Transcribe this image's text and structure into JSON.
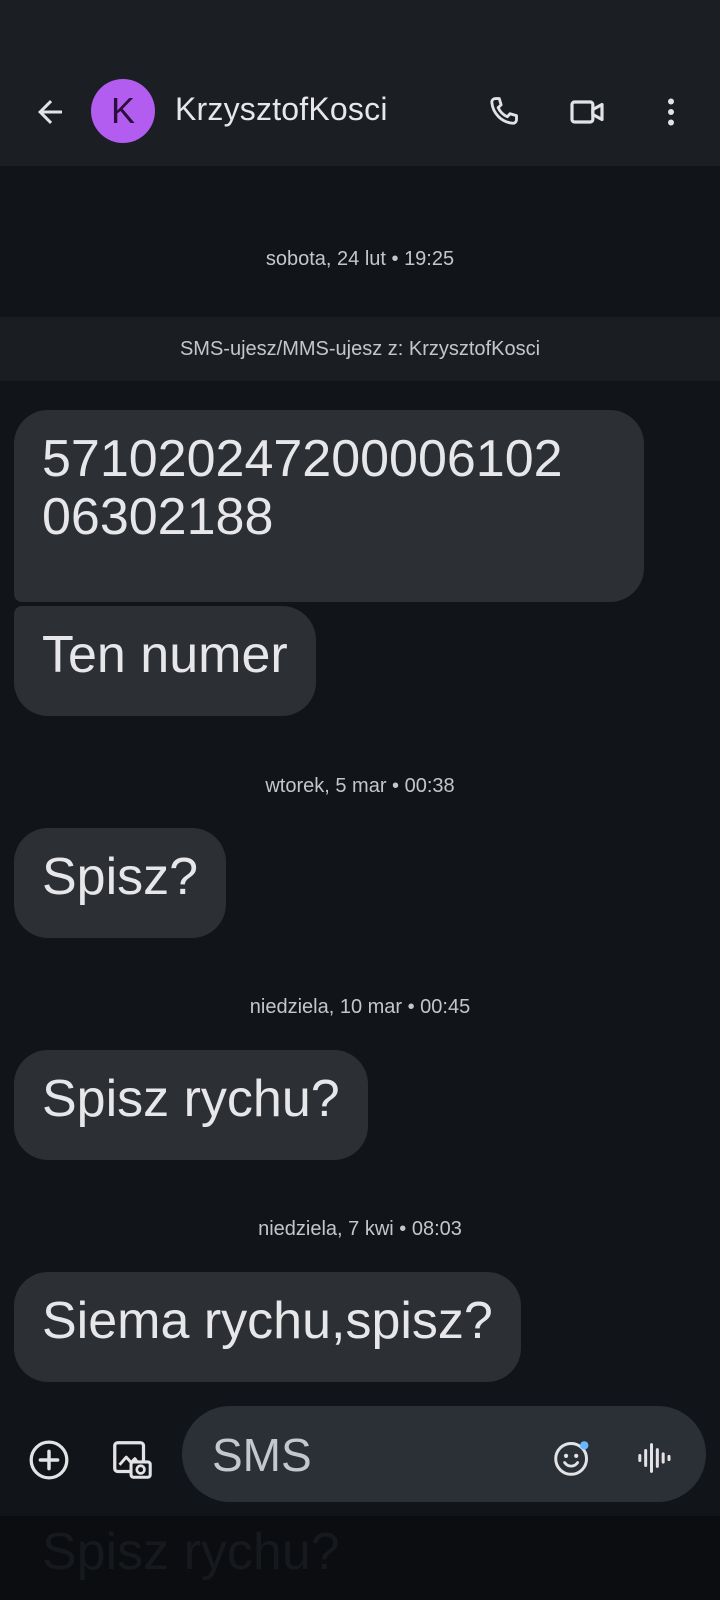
{
  "header": {
    "avatar_letter": "K",
    "contact_name": "KrzysztofKosci",
    "icons": [
      "back-arrow-icon",
      "phone-icon",
      "video-camera-icon",
      "more-vertical-icon"
    ]
  },
  "conversation": {
    "date_1": "sobota, 24 lut • 19:25",
    "banner": "SMS-ujesz/MMS-ujesz z: KrzysztofKosci",
    "message_1": "5710202472000061020 6302188",
    "message_1_line1": "57102024720000610​2",
    "message_1_line2": "06302188",
    "message_2": "Ten numer",
    "date_2": "wtorek, 5 mar • 00:38",
    "message_3": "Spisz?",
    "date_3": "niedziela, 10 mar • 00:45",
    "message_4": "Spisz rychu?",
    "date_4": "niedziela, 7 kwi • 08:03",
    "message_5": "Siema rychu,spisz?"
  },
  "compose": {
    "placeholder": "SMS",
    "icons": [
      "add-circle-icon",
      "gallery-icon",
      "emoji-icon",
      "voice-waveform-icon"
    ]
  },
  "ghost": {
    "text": "Spisz rychu?"
  },
  "colors": {
    "background": "#111419",
    "appbar": "#1b1f24",
    "bubble": "#2c2f33",
    "avatar": "#b25cf0",
    "compose_pill": "#2b2f36",
    "emoji_dot": "#6ab7ff"
  }
}
